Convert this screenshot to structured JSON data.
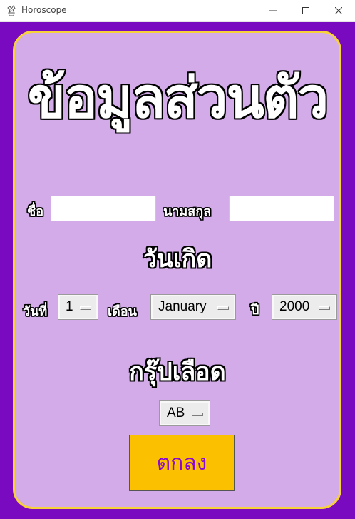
{
  "window": {
    "title": "Horoscope"
  },
  "main": {
    "title": "ข้อมูลส่วนตัว",
    "first_name_label": "ชื่อ",
    "first_name_value": "",
    "last_name_label": "นามสกุล",
    "last_name_value": "",
    "birthday_heading": "วันเกิด",
    "day_label": "วันที่",
    "day_value": "1",
    "month_label": "เดือน",
    "month_value": "January",
    "year_label": "ปี",
    "year_value": "2000",
    "blood_heading": "กรุ๊ปเลือด",
    "blood_value": "AB",
    "ok_label": "ตกลง"
  },
  "colors": {
    "window_bg": "#7a0abf",
    "panel_bg": "#d3abe9",
    "panel_border": "#f7d23a",
    "button_bg": "#fbc100",
    "button_text": "#8a0ad0"
  },
  "icons": [
    "app-icon",
    "minimize-icon",
    "maximize-icon",
    "close-icon",
    "dropdown-indicator-icon"
  ]
}
